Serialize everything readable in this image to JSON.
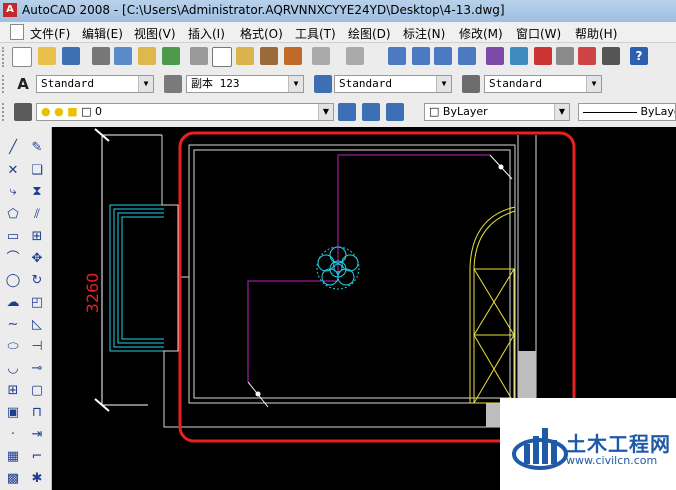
{
  "title": {
    "app": "AutoCAD 2008",
    "path": "[C:\\Users\\Administrator.AQRVNNXCYYE24YD\\Desktop\\4-13.dwg]"
  },
  "menu": [
    "文件(F)",
    "编辑(E)",
    "视图(V)",
    "插入(I)",
    "格式(O)",
    "工具(T)",
    "绘图(D)",
    "标注(N)",
    "修改(M)",
    "窗口(W)",
    "帮助(H)"
  ],
  "styles": {
    "text_style": "Standard",
    "dim_style": "副本 123",
    "table_style": "Standard",
    "multileader_style": "Standard"
  },
  "layers": {
    "current": "0",
    "color": "ByLayer",
    "linetype": "ByLayer"
  },
  "drawing": {
    "dimension": "3260"
  },
  "watermark": {
    "title": "土木工程网",
    "url": "www.civilcn.com"
  },
  "colors": {
    "highlight": "#e82020",
    "magenta": "#c21fc2",
    "cyan": "#22d3e6",
    "yellow": "#e8e23a"
  }
}
